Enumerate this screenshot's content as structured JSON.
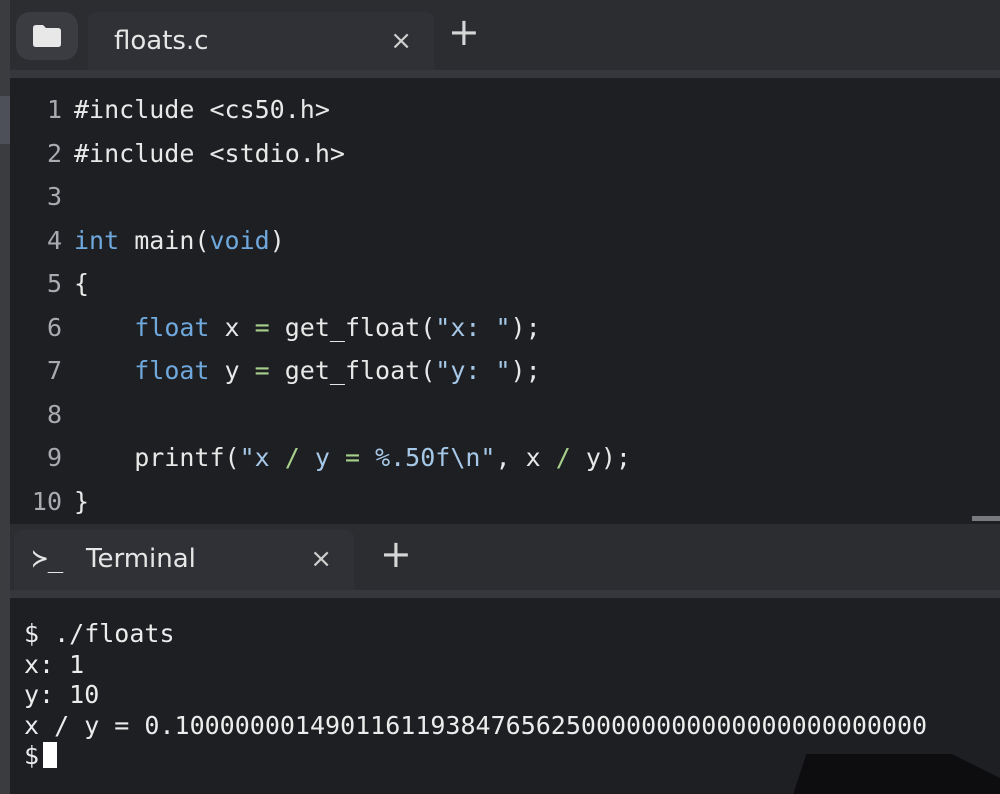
{
  "editor_tabs": {
    "active_tab": {
      "label": "floats.c",
      "close_glyph": "×"
    },
    "add_glyph": "+"
  },
  "code_lines": [
    {
      "number": "1",
      "parts": [
        [
          "#include <cs50.h>",
          "plain"
        ]
      ]
    },
    {
      "number": "2",
      "parts": [
        [
          "#include <stdio.h>",
          "plain"
        ]
      ]
    },
    {
      "number": "3",
      "parts": []
    },
    {
      "number": "4",
      "parts": [
        [
          "int",
          "kw"
        ],
        [
          " main(",
          "plain"
        ],
        [
          "void",
          "kw"
        ],
        [
          ")",
          "plain"
        ]
      ]
    },
    {
      "number": "5",
      "parts": [
        [
          "{",
          "plain"
        ]
      ]
    },
    {
      "number": "6",
      "parts": [
        [
          "    ",
          "plain"
        ],
        [
          "float",
          "kw"
        ],
        [
          " x ",
          "plain"
        ],
        [
          "=",
          "op"
        ],
        [
          " get_float(",
          "plain"
        ],
        [
          "\"x: \"",
          "str"
        ],
        [
          ");",
          "plain"
        ]
      ]
    },
    {
      "number": "7",
      "parts": [
        [
          "    ",
          "plain"
        ],
        [
          "float",
          "kw"
        ],
        [
          " y ",
          "plain"
        ],
        [
          "=",
          "op"
        ],
        [
          " get_float(",
          "plain"
        ],
        [
          "\"y: \"",
          "str"
        ],
        [
          ");",
          "plain"
        ]
      ]
    },
    {
      "number": "8",
      "parts": []
    },
    {
      "number": "9",
      "parts": [
        [
          "    printf(",
          "plain"
        ],
        [
          "\"x ",
          "str"
        ],
        [
          "/",
          "op"
        ],
        [
          " y ",
          "str"
        ],
        [
          "=",
          "op"
        ],
        [
          " %.50f\\n\"",
          "str"
        ],
        [
          ", x ",
          "plain"
        ],
        [
          "/",
          "op"
        ],
        [
          " y);",
          "plain"
        ]
      ]
    },
    {
      "number": "10",
      "parts": [
        [
          "}",
          "plain"
        ]
      ]
    }
  ],
  "terminal_tab": {
    "icon": "≻_",
    "label": "Terminal",
    "close_glyph": "×",
    "add_glyph": "+"
  },
  "terminal_lines": [
    "$ ./floats",
    "x: 1",
    "y: 10",
    "x / y = 0.10000000149011611938476562500000000000000000000000"
  ],
  "terminal_prompt": "$",
  "colors": {
    "keyword": "#6fa8dc",
    "string": "#a6c8e8",
    "operator": "#a8d08d",
    "text": "#e8e8e8",
    "background": "#1e1f22"
  }
}
